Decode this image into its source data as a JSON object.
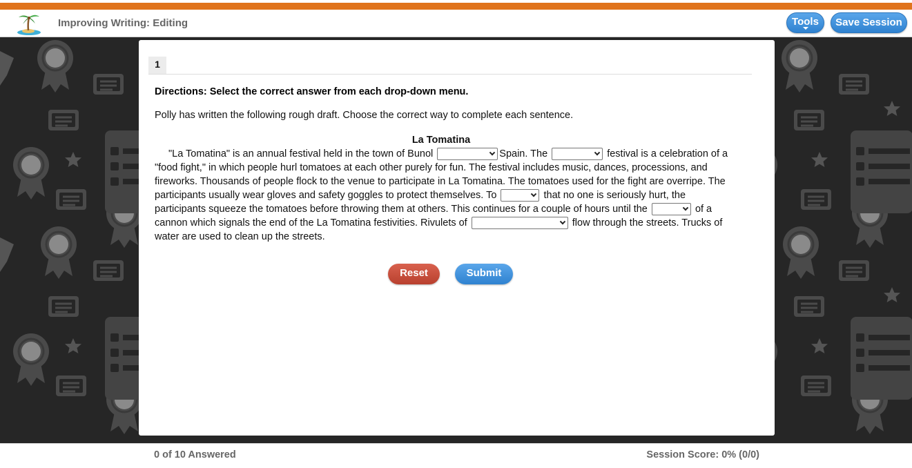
{
  "header": {
    "title": "Improving Writing: Editing",
    "tools_label": "Tools",
    "save_label": "Save Session"
  },
  "question": {
    "tab_number": "1",
    "directions": "Directions: Select the correct answer from each drop-down menu.",
    "intro": "Polly has written the following rough draft. Choose the correct way to complete each sentence.",
    "passage_title": "La Tomatina",
    "segments": [
      "\"La Tomatina\" is an annual festival held in the town of Bunol",
      "Spain. The",
      "festival is a celebration of a \"food fight,\" in which people hurl tomatoes at each other purely for fun. The festival includes music, dances, processions, and fireworks. Thousands of people flock to the venue to participate in La Tomatina. The tomatoes used for the fight are overripe. The participants usually wear gloves and safety goggles to protect themselves. To",
      "that no one is seriously hurt, the participants squeeze the tomatoes before throwing them at others. This continues for a couple of hours until the",
      "of a cannon which signals the end of the La Tomatina festivities. Rivulets of",
      "flow through the streets. Trucks of water are used to clean up the streets."
    ],
    "dropdowns": [
      "",
      "",
      "",
      "",
      ""
    ]
  },
  "buttons": {
    "reset": "Reset",
    "submit": "Submit"
  },
  "footer": {
    "answered": "0 of 10 Answered",
    "score": "Session Score: 0% (0/0)"
  },
  "colors": {
    "accent_orange": "#e0731c",
    "button_blue": "#3a8ddb",
    "button_red": "#c84f3c",
    "background_dark": "#262626"
  },
  "icons": [
    "palm-tree-logo-icon",
    "award-ribbon-icon",
    "certificate-icon",
    "star-icon"
  ]
}
